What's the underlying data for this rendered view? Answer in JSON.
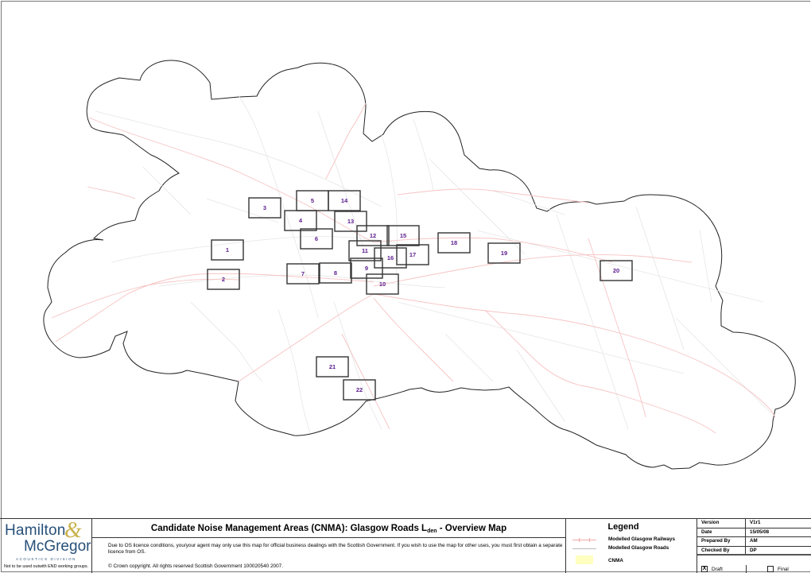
{
  "map": {
    "title": "Candidate Noise Management Areas (CNMA): Glasgow Roads L",
    "title_subscript": "den",
    "title_suffix": " - Overview Map",
    "cnma_areas": [
      {
        "id": "1",
        "label": "1"
      },
      {
        "id": "2",
        "label": "2"
      },
      {
        "id": "3",
        "label": "3"
      },
      {
        "id": "4",
        "label": "4"
      },
      {
        "id": "5",
        "label": "5"
      },
      {
        "id": "6",
        "label": "6"
      },
      {
        "id": "7",
        "label": "7"
      },
      {
        "id": "8",
        "label": "8"
      },
      {
        "id": "9",
        "label": "9"
      },
      {
        "id": "10",
        "label": "10"
      },
      {
        "id": "11",
        "label": "11"
      },
      {
        "id": "12",
        "label": "12"
      },
      {
        "id": "13",
        "label": "13"
      },
      {
        "id": "14",
        "label": "14"
      },
      {
        "id": "15",
        "label": "15"
      },
      {
        "id": "16",
        "label": "16"
      },
      {
        "id": "17",
        "label": "17"
      },
      {
        "id": "18",
        "label": "18"
      },
      {
        "id": "19",
        "label": "19"
      },
      {
        "id": "20",
        "label": "20"
      },
      {
        "id": "21",
        "label": "21"
      },
      {
        "id": "22",
        "label": "22"
      }
    ],
    "colors": {
      "railway": "#f7c3c3",
      "road": "#e6e6e6",
      "cnma_fill": "#ffffc0",
      "label": "#5b1a8c",
      "boundary": "#222222"
    }
  },
  "logo": {
    "line1": "Hamilton",
    "ampersand": "&",
    "line2": "McGregor",
    "division": "ACOUSTICS DIVISION",
    "note": "Not to be used outwith END working groups."
  },
  "notes": {
    "licence": "Due to OS licence conditions, you/your agent may only use this map for official business dealings with the Scottish Government. If you wish to use the map for other uses, you must first obtain a separate licence from OS.",
    "copyright": "© Crown copyright. All rights reserved  Scottish Government 100020540 2007."
  },
  "legend": {
    "title": "Legend",
    "items": [
      {
        "label": "Modelled Glasgow Railways",
        "icon": "railway-line"
      },
      {
        "label": "Modelled Glasgow Roads",
        "icon": "road-line"
      },
      {
        "label": "CNMA",
        "icon": "cnma-swatch"
      }
    ]
  },
  "info": {
    "rows": [
      {
        "key": "Version",
        "value": "V1r1"
      },
      {
        "key": "Date",
        "value": "15/05/08"
      },
      {
        "key": "Prepared By",
        "value": "AM"
      },
      {
        "key": "Checked By",
        "value": "DP"
      }
    ],
    "status": [
      {
        "label": "Draft",
        "checked": true,
        "mark": "X"
      },
      {
        "label": "Final",
        "checked": false,
        "mark": ""
      }
    ]
  }
}
